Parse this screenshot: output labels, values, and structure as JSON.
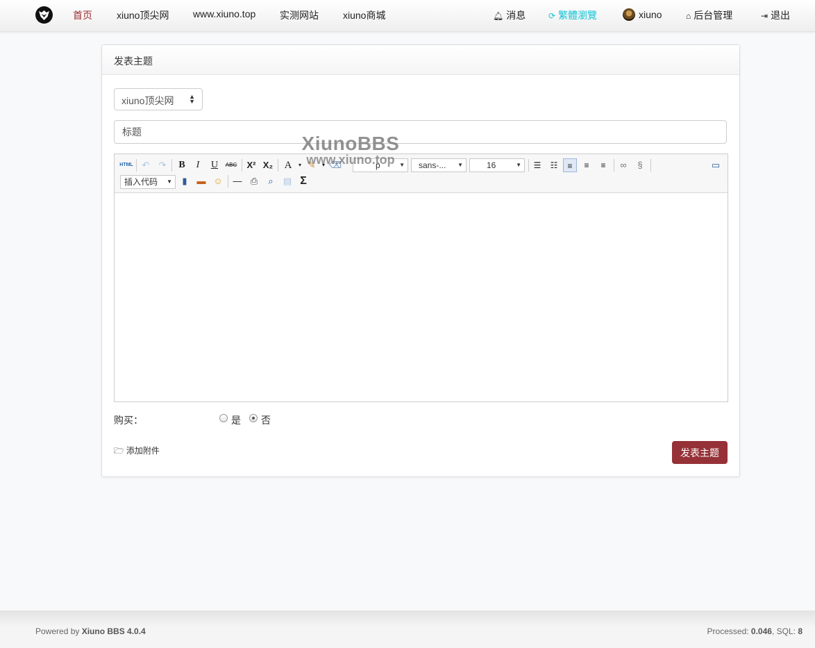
{
  "nav": {
    "home": "首页",
    "links": [
      "xiuno顶尖网",
      "www.xiuno.top",
      "实测网站",
      "xiuno商城"
    ],
    "messages": "消息",
    "traditional": "繁體瀏覽",
    "user": "xiuno",
    "admin": "后台管理",
    "logout": "退出",
    "accent_color": "#9a2f2f",
    "traditional_color": "#17c4d6"
  },
  "form": {
    "header": "发表主题",
    "forum_selected": "xiuno顶尖网",
    "title_placeholder": "标题",
    "buy_label": "购买：",
    "buy_yes": "是",
    "buy_no": "否",
    "buy_selected": "否",
    "attach_label": "添加附件",
    "submit_label": "发表主题",
    "submit_color": "#953137"
  },
  "editor": {
    "html_label": "HTML",
    "paragraph_value": "p",
    "font_family_value": "sans-...",
    "font_size_value": "16",
    "insert_code_label": "插入代码",
    "tools": [
      "html-source",
      "undo",
      "redo",
      "bold",
      "italic",
      "underline",
      "strikethrough",
      "superscript",
      "subscript",
      "font-color",
      "background-color",
      "clear-format",
      "paragraph",
      "font-family",
      "font-size",
      "ordered-list",
      "unordered-list",
      "align-left",
      "align-center",
      "align-right",
      "link",
      "unlink",
      "fullscreen",
      "insert-code",
      "insert-video",
      "insert-image",
      "emotion",
      "horizontal-rule",
      "print",
      "preview",
      "paste-plain",
      "formula"
    ]
  },
  "watermark": {
    "line1": "XiunoBBS",
    "line2": "www.xiuno.top"
  },
  "footer": {
    "powered_prefix": "Powered by ",
    "powered_name": "Xiuno BBS 4.0.4",
    "processed_label": "Processed: ",
    "processed_value": "0.046",
    "sql_label": ", SQL: ",
    "sql_value": "8"
  }
}
